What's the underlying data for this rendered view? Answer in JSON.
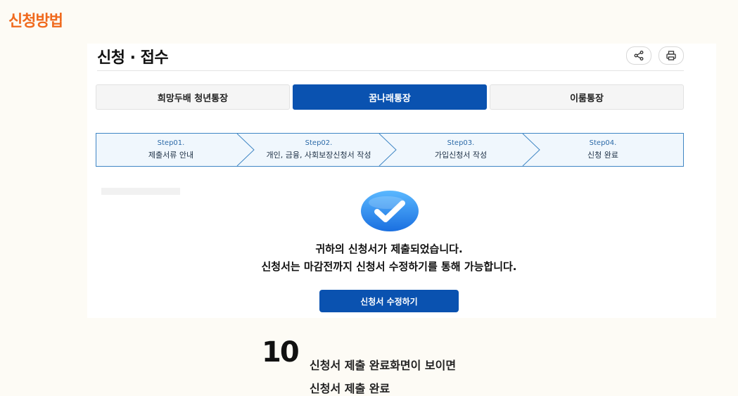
{
  "section_title": "신청방법",
  "page_title": "신청 · 접수",
  "tabs": [
    {
      "label": "희망두배 청년통장",
      "active": false
    },
    {
      "label": "꿈나래통장",
      "active": true
    },
    {
      "label": "이룸통장",
      "active": false
    }
  ],
  "steps": [
    {
      "num": "Step01.",
      "label": "제출서류 안내"
    },
    {
      "num": "Step02.",
      "label": "개인, 금융, 사회보장신청서 작성"
    },
    {
      "num": "Step03.",
      "label": "가입신청서 작성"
    },
    {
      "num": "Step04.",
      "label": "신청 완료"
    }
  ],
  "message_line1": "귀하의 신청서가 제출되었습니다.",
  "message_line2": "신청서는 마감전까지 신청서 수정하기를 통해 가능합니다.",
  "edit_button": "신청서 수정하기",
  "step_number": "10",
  "caption_line1": "신청서 제출 완료화면이 보이면",
  "caption_line2": "신청서 제출 완료",
  "icons": {
    "share": "share-icon",
    "print": "print-icon",
    "check": "check-icon"
  },
  "colors": {
    "accent": "#f06a1e",
    "primary": "#0a52b0",
    "step_border": "#3f86c4"
  }
}
